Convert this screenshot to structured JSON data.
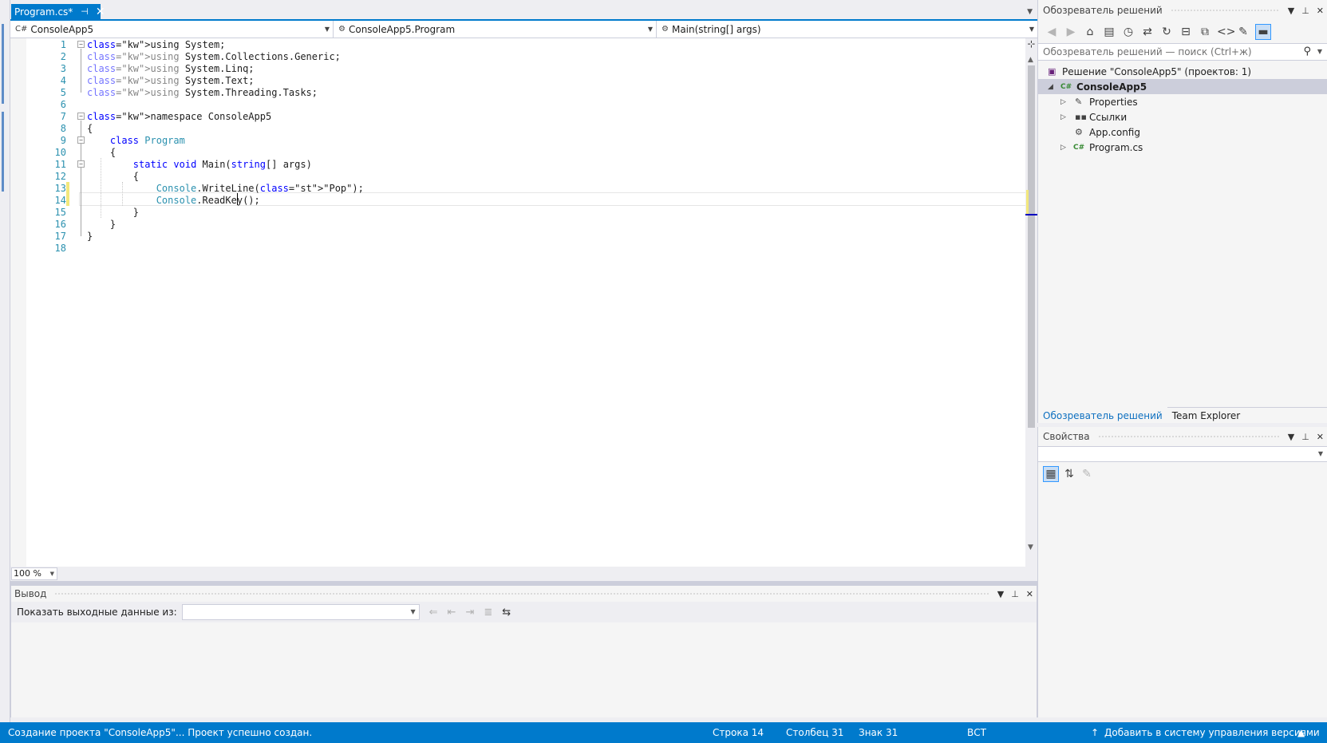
{
  "doc_tab": {
    "title": "Program.cs*",
    "pin": "⊣",
    "close": "✕"
  },
  "navbar": {
    "project": "ConsoleApp5",
    "class": "ConsoleApp5.Program",
    "member": "Main(string[] args)"
  },
  "code": {
    "line_numbers": [
      "1",
      "2",
      "3",
      "4",
      "5",
      "6",
      "7",
      "8",
      "9",
      "10",
      "11",
      "12",
      "13",
      "14",
      "15",
      "16",
      "17",
      "18"
    ],
    "lines": [
      "using System;",
      "using System.Collections.Generic;",
      "using System.Linq;",
      "using System.Text;",
      "using System.Threading.Tasks;",
      "",
      "namespace ConsoleApp5",
      "{",
      "    class Program",
      "    {",
      "        static void Main(string[] args)",
      "        {",
      "            Console.WriteLine(\"Pop\");",
      "            Console.ReadKey();",
      "        }",
      "    }",
      "}",
      ""
    ]
  },
  "zoom": "100 %",
  "output": {
    "title": "Вывод",
    "show_from_label": "Показать выходные данные из:",
    "source_value": ""
  },
  "solution_explorer": {
    "title": "Обозреватель решений",
    "search_placeholder": "Обозреватель решений — поиск (Ctrl+ж)",
    "tree": [
      {
        "label": "Решение \"ConsoleApp5\"  (проектов: 1)",
        "icon": "solution-icon"
      },
      {
        "label": "ConsoleApp5",
        "icon": "csharp-project-icon"
      },
      {
        "label": "Properties",
        "icon": "wrench-icon"
      },
      {
        "label": "Ссылки",
        "icon": "references-icon"
      },
      {
        "label": "App.config",
        "icon": "config-file-icon"
      },
      {
        "label": "Program.cs",
        "icon": "csharp-file-icon"
      }
    ],
    "tabs": [
      "Обозреватель решений",
      "Team Explorer"
    ]
  },
  "properties": {
    "title": "Свойства"
  },
  "status": {
    "message": "Создание проекта \"ConsoleApp5\"... Проект успешно создан.",
    "line": "Строка 14",
    "column": "Столбец 31",
    "char": "Знак 31",
    "mode": "ВСТ",
    "source_control": "Добавить в систему управления версиями"
  },
  "colors": {
    "accent": "#007acc",
    "keyword": "#0000ff",
    "type": "#2b91af",
    "string": "#a31515",
    "change_marker": "#f2e77d"
  }
}
